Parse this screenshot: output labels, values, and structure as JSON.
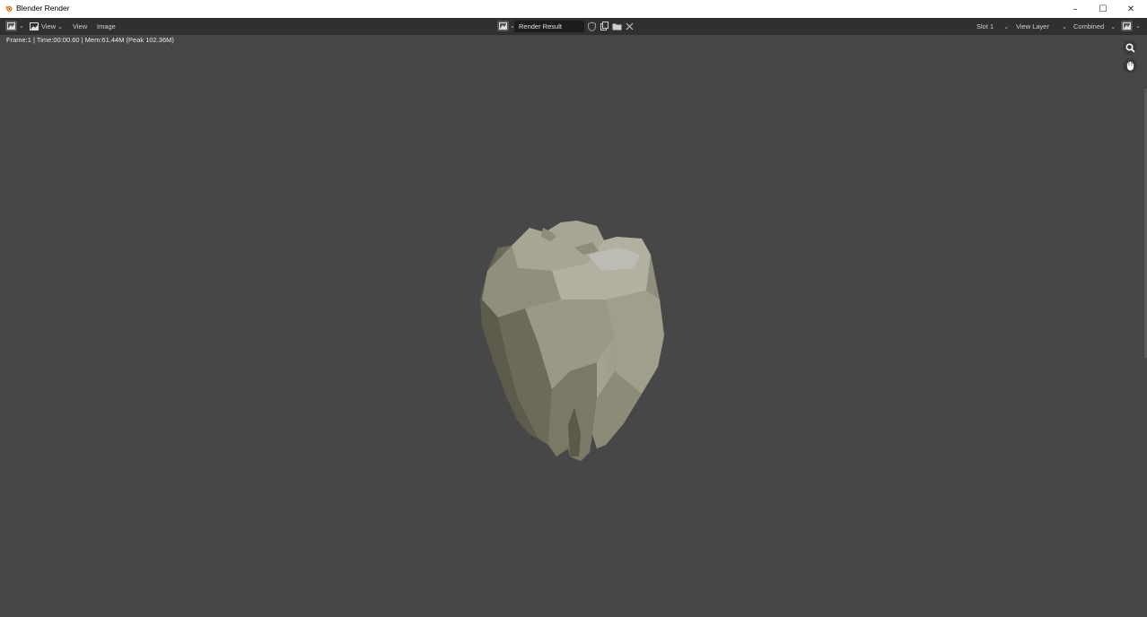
{
  "window": {
    "title": "Blender Render",
    "controls": {
      "minimize": "–",
      "maximize": "☐",
      "close": "✕"
    }
  },
  "header": {
    "view_menu_label": "View",
    "menus": [
      "View",
      "Image"
    ],
    "image_name": "Render Result",
    "slot": "Slot 1",
    "view_layer": "View Layer",
    "pass": "Combined"
  },
  "info": {
    "text": "Frame:1 | Time:00:00.60 | Mem:61.44M (Peak 102.36M)"
  },
  "icons": {
    "app": "blender-logo-icon",
    "editor_type": "image-editor-icon",
    "mode": "view-mode-icon",
    "browse": "image-browse-icon",
    "fake_user": "shield-icon",
    "new": "new-image-icon",
    "open": "folder-icon",
    "unlink": "close-icon",
    "display": "display-channels-icon",
    "zoom": "zoom-icon",
    "pan": "hand-icon"
  },
  "colors": {
    "titlebar": "#ffffff",
    "header": "#303030",
    "viewport": "#464646",
    "accent": "#e87d0d"
  }
}
